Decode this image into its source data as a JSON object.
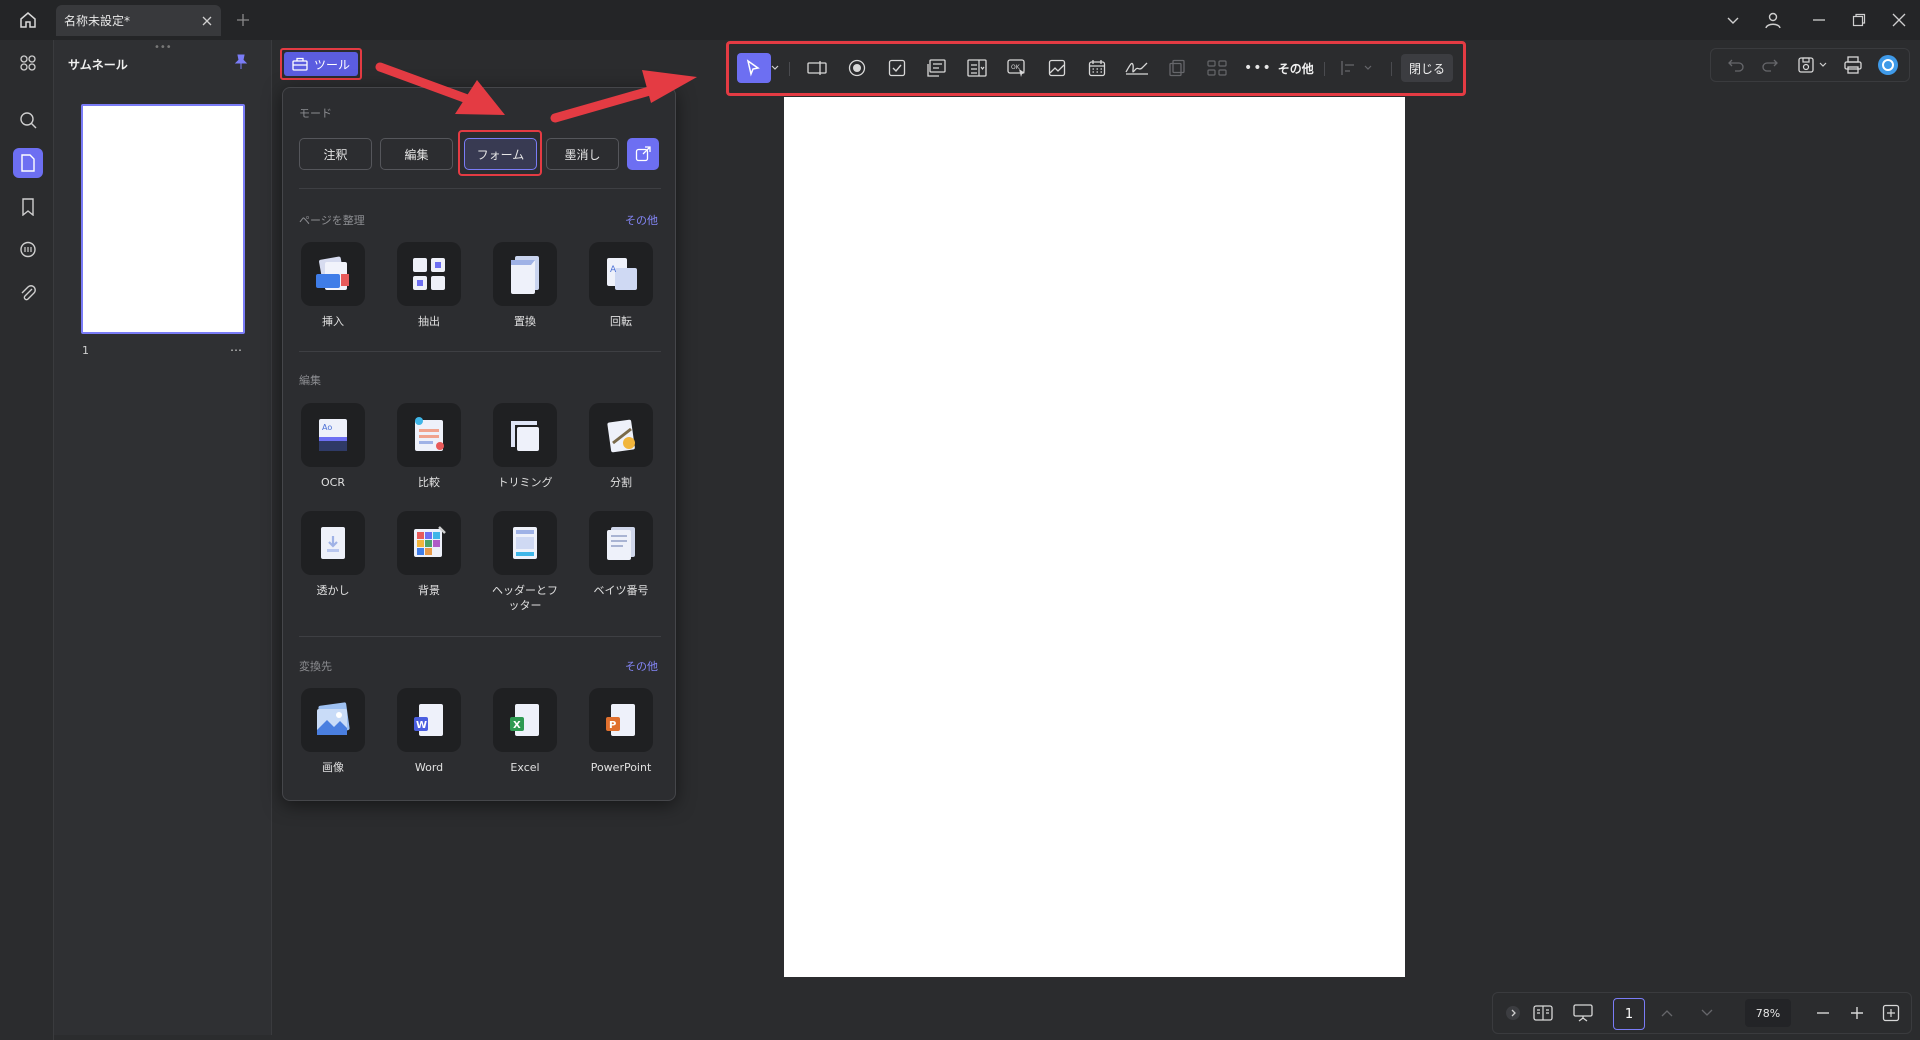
{
  "tab": {
    "title": "名称未設定*"
  },
  "thumbnails": {
    "title": "サムネール",
    "page_label": "1",
    "more": "…"
  },
  "tool_button": {
    "label": "ツール"
  },
  "tools_panel": {
    "mode_label": "モード",
    "modes": [
      "注釈",
      "編集",
      "フォーム",
      "墨消し"
    ],
    "active_mode": "フォーム",
    "organize": {
      "label": "ページを整理",
      "more": "その他",
      "items": [
        "挿入",
        "抽出",
        "置換",
        "回転"
      ]
    },
    "edit": {
      "label": "編集",
      "items": [
        "OCR",
        "比較",
        "トリミング",
        "分割",
        "透かし",
        "背景",
        "ヘッダーとフ\nッター",
        "ベイツ番号"
      ]
    },
    "convert": {
      "label": "変換先",
      "more": "その他",
      "items": [
        "画像",
        "Word",
        "Excel",
        "PowerPoint"
      ]
    }
  },
  "form_toolbar": {
    "more_label": "その他",
    "close_label": "閉じる",
    "icons": [
      "select-pointer-icon",
      "text-field-icon",
      "radio-button-icon",
      "checkbox-icon",
      "list-box-icon",
      "dropdown-icon",
      "button-icon",
      "image-field-icon",
      "date-field-icon",
      "signature-icon",
      "copy-field-icon",
      "grid-icon",
      "align-icon"
    ]
  },
  "bottom_bar": {
    "page": "1",
    "zoom": "78%"
  },
  "colors": {
    "accent": "#6d6ff2",
    "highlight": "#e43b43",
    "bg": "#2b2c2e"
  }
}
